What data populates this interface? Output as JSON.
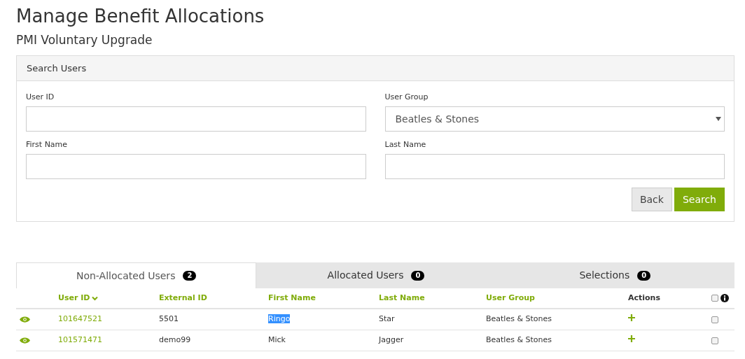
{
  "title": "Manage Benefit Allocations",
  "subtitle": "PMI Voluntary Upgrade",
  "search_panel": {
    "title": "Search Users",
    "fields": [
      {
        "label": "User ID",
        "kind": "text"
      },
      {
        "label": "User Group",
        "kind": "select",
        "value": "Beatles & Stones"
      },
      {
        "label": "First Name",
        "kind": "text"
      },
      {
        "label": "Last Name",
        "kind": "text"
      }
    ],
    "buttons": [
      {
        "label": "Back",
        "kind": "secondary"
      },
      {
        "label": "Search",
        "kind": "primary"
      }
    ]
  },
  "tabs": [
    {
      "label": "Non-Allocated Users",
      "count": "2",
      "selected": true
    },
    {
      "label": "Allocated Users",
      "count": "0",
      "selected": false
    },
    {
      "label": "Selections",
      "count": "0",
      "selected": false
    }
  ],
  "table": {
    "columns": [
      {
        "label": "User ID",
        "sortable": true,
        "sorted": true
      },
      {
        "label": "External ID",
        "sortable": true,
        "sorted": false
      },
      {
        "label": "First Name",
        "sortable": true,
        "sorted": false
      },
      {
        "label": "Last Name",
        "sortable": true,
        "sorted": false
      },
      {
        "label": "User Group",
        "sortable": true,
        "sorted": false
      },
      {
        "label": "Actions",
        "sortable": false,
        "sorted": false
      }
    ],
    "select_all_checked": false,
    "rows": [
      {
        "user_id": "101647521",
        "external_id": "5501",
        "first_name": "Ringo",
        "first_name_highlighted": true,
        "last_name": "Star",
        "user_group": "Beatles & Stones",
        "checked": false
      },
      {
        "user_id": "101571471",
        "external_id": "demo99",
        "first_name": "Mick",
        "first_name_highlighted": false,
        "last_name": "Jagger",
        "user_group": "Beatles & Stones",
        "checked": false
      }
    ]
  }
}
